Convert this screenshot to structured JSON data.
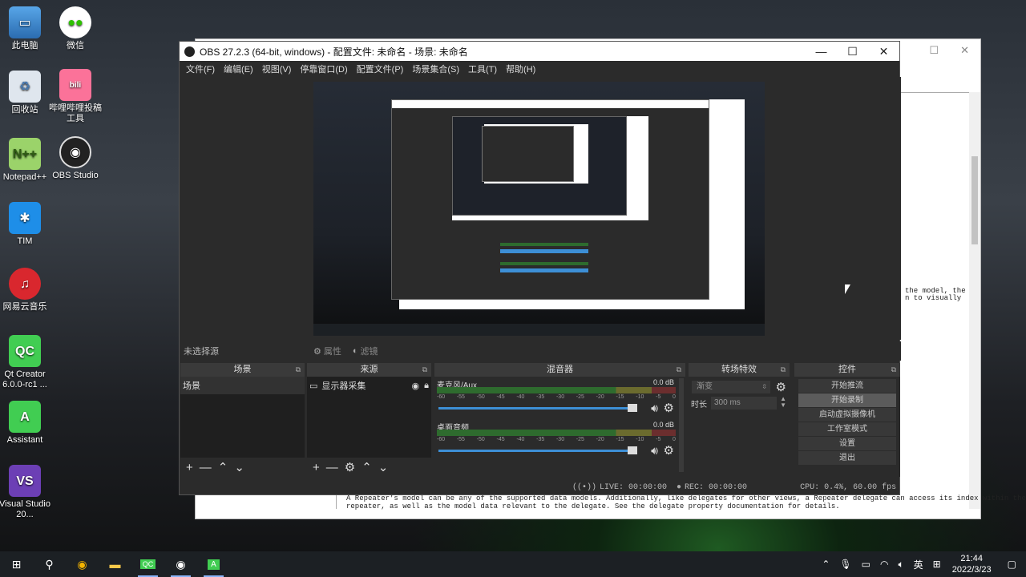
{
  "desktop": {
    "icons": [
      {
        "label": "此电脑",
        "icon": "computer-icon"
      },
      {
        "label": "微信",
        "icon": "wechat-icon"
      },
      {
        "label": "回收站",
        "icon": "recycle-bin-icon"
      },
      {
        "label": "哔哩哔哩投稿工具",
        "icon": "bilibili-icon"
      },
      {
        "label": "Notepad++",
        "icon": "notepad-plus-icon"
      },
      {
        "label": "OBS Studio",
        "icon": "obs-icon"
      },
      {
        "label": "TIM",
        "icon": "tim-icon"
      },
      {
        "label": "网易云音乐",
        "icon": "netease-music-icon"
      },
      {
        "label": "Qt Creator 6.0.0-rc1 ...",
        "icon": "qt-creator-icon"
      },
      {
        "label": "Assistant",
        "icon": "assistant-icon"
      },
      {
        "label": "Visual Studio 20...",
        "icon": "visual-studio-icon"
      }
    ]
  },
  "bg_window": {
    "text_right_1": "the model, the",
    "text_right_2": "n to visually",
    "text_bottom_1": "A Repeater's model can be any of the supported data models. Additionally, like delegates for other views, a Repeater delegate can access its index within the",
    "text_bottom_2": "repeater, as well as the model data relevant to the delegate. See the delegate property documentation for details."
  },
  "obs": {
    "title": "OBS 27.2.3 (64-bit, windows) - 配置文件: 未命名 - 场景: 未命名",
    "menu": [
      "文件(F)",
      "编辑(E)",
      "视图(V)",
      "停靠窗口(D)",
      "配置文件(P)",
      "场景集合(S)",
      "工具(T)",
      "帮助(H)"
    ],
    "source_toolbar": {
      "no_selection": "未选择源",
      "properties": "属性",
      "filters": "滤镜"
    },
    "docks": {
      "scenes": {
        "title": "场景",
        "items": [
          "场景"
        ]
      },
      "sources": {
        "title": "来源",
        "items": [
          "显示器采集"
        ]
      },
      "mixer": {
        "title": "混音器",
        "scale": [
          "-60",
          "-55",
          "-50",
          "-45",
          "-40",
          "-35",
          "-30",
          "-25",
          "-20",
          "-15",
          "-10",
          "-5",
          "0"
        ],
        "channels": [
          {
            "name": "麦克风/Aux",
            "db": "0.0 dB"
          },
          {
            "name": "桌面音频",
            "db": "0.0 dB"
          }
        ]
      },
      "transitions": {
        "title": "转场特效",
        "selected": "渐变",
        "duration_label": "时长",
        "duration_value": "300 ms"
      },
      "controls": {
        "title": "控件",
        "buttons": [
          "开始推流",
          "开始录制",
          "启动虚拟摄像机",
          "工作室模式",
          "设置",
          "退出"
        ]
      }
    },
    "status": {
      "live": "LIVE: 00:00:00",
      "rec": "REC: 00:00:00",
      "cpu": "CPU: 0.4%, 60.00 fps"
    }
  },
  "taskbar": {
    "ime": "英",
    "time": "21:44",
    "date": "2022/3/23"
  }
}
